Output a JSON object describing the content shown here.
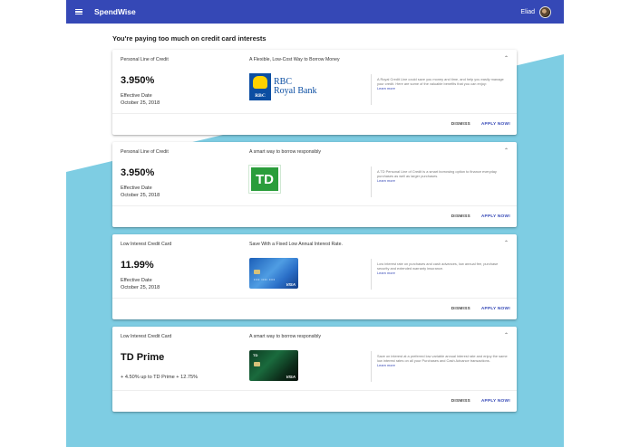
{
  "app": {
    "title": "SpendWise",
    "user_name": "Eliad"
  },
  "heading": "You're paying too much on credit card interests",
  "colors": {
    "appbar": "#3548b6",
    "wave": "#7ecde3",
    "accent": "#3548b6"
  },
  "cards": [
    {
      "type": "Personal Line of Credit",
      "tagline": "A Flexible, Low-Cost Way to Borrow Money",
      "rate": "3.950%",
      "effective_label": "Effective Date",
      "effective_date": "October 25, 2018",
      "logo": "rbc-royal-bank-logo",
      "logo_abbr": "RBC",
      "logo_text_line1": "RBC",
      "logo_text_line2": "Royal Bank",
      "description": "A Royal Credit Line could save you money and time, and help you easily manage your credit. Here are some of the valuable benefits that you can enjoy:",
      "learn_more": "Learn more",
      "dismiss": "DISMISS",
      "apply": "APPLY NOW!"
    },
    {
      "type": "Personal Line of Credit",
      "tagline": "A smart way to borrow responsibly",
      "rate": "3.950%",
      "effective_label": "Effective Date",
      "effective_date": "October 25, 2018",
      "logo": "td-logo",
      "logo_text": "TD",
      "description": "A TD Personal Line of Credit is a smart borrowing option to finance everyday purchases as well as larger purchases.",
      "learn_more": "Learn more",
      "dismiss": "DISMISS",
      "apply": "APPLY NOW!"
    },
    {
      "type": "Low Interest Credit Card",
      "tagline": "Save With a Fixed Low Annual Interest Rate.",
      "rate": "11.99%",
      "effective_label": "Effective Date",
      "effective_date": "October 25, 2018",
      "logo": "blue-visa-card-image",
      "card_network": "VISA",
      "description": "Low interest rate on purchases and cash advances, low annual fee, purchase security and extended warranty insurance.",
      "learn_more": "Learn more",
      "dismiss": "DISMISS",
      "apply": "APPLY NOW!"
    },
    {
      "type": "Low Interest Credit Card",
      "tagline": "A smart way to borrow responsibly",
      "rate": "TD Prime",
      "prime_detail": "+ 4.50% up to TD Prime + 12.75%",
      "logo": "td-green-visa-card-image",
      "card_brand": "TD",
      "card_network": "VISA",
      "description": "Save on interest at a preferred low variable annual interest rate and enjoy the same low interest rates on all your Purchases and Cash Advance transactions.",
      "learn_more": "Learn more",
      "dismiss": "DISMISS",
      "apply": "APPLY NOW!"
    }
  ]
}
